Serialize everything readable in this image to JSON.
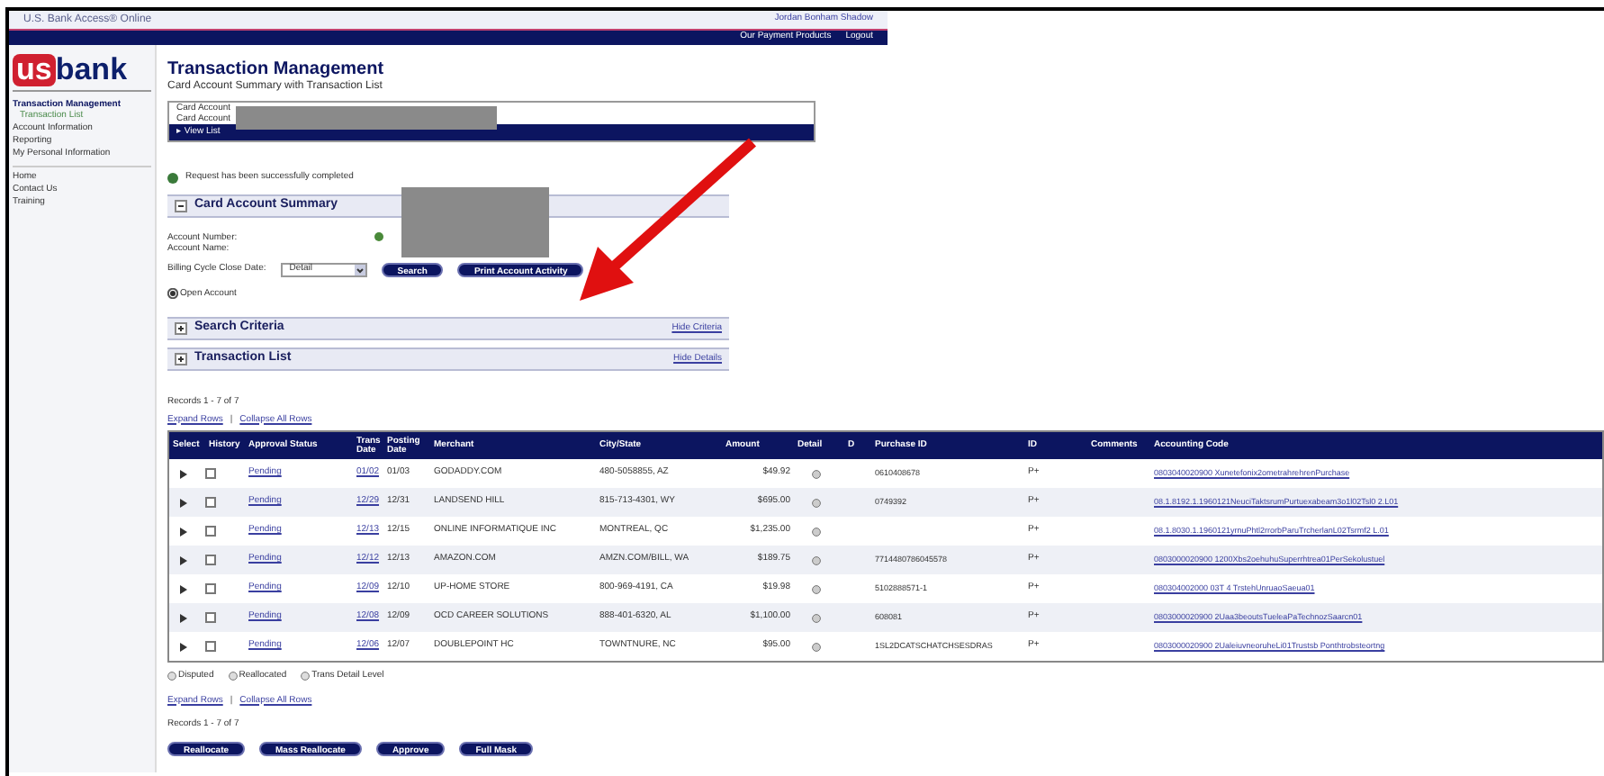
{
  "header": {
    "site_title": "U.S. Bank Access® Online",
    "user_name": "Jordan Bonham Shadow",
    "links": [
      "Our Payment Products",
      "Logout"
    ]
  },
  "logo": {
    "prefix": "us",
    "name": "bank"
  },
  "sidebar": {
    "items": [
      {
        "label": "Transaction Management",
        "selected": true,
        "children": [
          {
            "label": "Transaction List",
            "selected": false
          }
        ]
      },
      {
        "label": "Account Information",
        "selected": false
      },
      {
        "label": "Reporting",
        "selected": false
      },
      {
        "label": "My Personal Information",
        "selected": false
      }
    ],
    "links": [
      "Home",
      "Contact Us",
      "Training"
    ]
  },
  "page": {
    "title": "Transaction Management",
    "subtitle": "Card Account Summary with Transaction List"
  },
  "account_box": {
    "lines": [
      "Card Account",
      "Card Account"
    ],
    "bar_label": "▸ View List"
  },
  "message": "Request has been successfully completed",
  "card_summary": {
    "title": "Card Account Summary",
    "expanded": true,
    "fields": [
      "Account Number:",
      "Account Name:"
    ],
    "cycle_label": "Billing Cycle Close Date:",
    "cycle_value": "Detail",
    "buttons": [
      "Search",
      "Print Account Activity"
    ],
    "radio": {
      "label": "Open Account",
      "selected": true
    }
  },
  "sections": [
    {
      "title": "Search Criteria",
      "expanded": false,
      "link": "Hide Criteria"
    },
    {
      "title": "Transaction List",
      "expanded": false,
      "link": "Hide Details"
    }
  ],
  "records_top": "Records 1 - 7 of 7",
  "expand_links_top": [
    "Expand Rows",
    "|",
    "Collapse All Rows"
  ],
  "table": {
    "columns": [
      "Select",
      "History",
      "Approval Status",
      "Trans Date",
      "Posting Date",
      "Merchant",
      "City/State",
      "Amount",
      "Detail",
      "D",
      "Purchase ID",
      "ID",
      "Comments",
      "Accounting Code"
    ],
    "rows": [
      {
        "checked": false,
        "status": "Pending",
        "trans": "01/02",
        "posting": "01/03",
        "merchant": "GODADDY.COM",
        "city": "480-5058855, AZ",
        "amount": "$49.92",
        "purchase_id": "0610408678",
        "id": "P+",
        "code": "0803040020900 Xunetefonix2ometrahrehrenPurchase"
      },
      {
        "checked": false,
        "status": "Pending",
        "trans": "12/29",
        "posting": "12/31",
        "merchant": "LANDSEND HILL",
        "city": "815-713-4301, WY",
        "amount": "$695.00",
        "purchase_id": "0749392",
        "id": "P+",
        "code": "08.1.8192.1.1960121NeuciTaktsrumPurtuexabeam3o1l02Tsl0 2.L01"
      },
      {
        "checked": false,
        "status": "Pending",
        "trans": "12/13",
        "posting": "12/15",
        "merchant": "ONLINE INFORMATIQUE INC",
        "city": "MONTREAL, QC",
        "amount": "$1,235.00",
        "id": "P+",
        "code": "08.1.8030.1.1960121yrnuPhtl2rrorbParuTrcherlanL02Tsrmf2 L.01"
      },
      {
        "checked": false,
        "status": "Pending",
        "trans": "12/12",
        "posting": "12/13",
        "merchant": "AMAZON.COM",
        "city": "AMZN.COM/BILL, WA",
        "amount": "$189.75",
        "purchase_id": "7714480786045578",
        "id": "P+",
        "code": "0803000020900 1200Xbs2oehuhuSuperrhtrea01PerSekolustuel"
      },
      {
        "checked": false,
        "status": "Pending",
        "trans": "12/09",
        "posting": "12/10",
        "merchant": "UP-HOME STORE",
        "city": "800-969-4191, CA",
        "amount": "$19.98",
        "purchase_id": "5102888571-1",
        "id": "P+",
        "code": "080304002000 03T 4 TrstehUnruaoSaeua01"
      },
      {
        "checked": false,
        "status": "Pending",
        "trans": "12/08",
        "posting": "12/09",
        "merchant": "OCD CAREER SOLUTIONS",
        "city": "888-401-6320, AL",
        "amount": "$1,100.00",
        "purchase_id": "608081",
        "id": "P+",
        "code": "0803000020900 2Uaa3beoutsTueleaPaTechnozSaarcn01"
      },
      {
        "checked": false,
        "status": "Pending",
        "trans": "12/06",
        "posting": "12/07",
        "merchant": "DOUBLEPOINT HC",
        "city": "TOWNTNURE, NC",
        "amount": "$95.00",
        "purchase_id": "1SL2DCATSCHATCHSESDRAS",
        "id": "P+",
        "code": "0803000020900 2UaleiuvneoruheLi01Trustsb Ponthtrobsteortng"
      }
    ]
  },
  "legend": [
    "Disputed",
    "Reallocated",
    "Trans Detail Level"
  ],
  "expand_links_bottom": [
    "Expand Rows",
    "|",
    "Collapse All Rows"
  ],
  "records_bottom": "Records 1 - 7 of 7",
  "actions": [
    "Reallocate",
    "Mass Reallocate",
    "Approve",
    "Full Mask"
  ]
}
